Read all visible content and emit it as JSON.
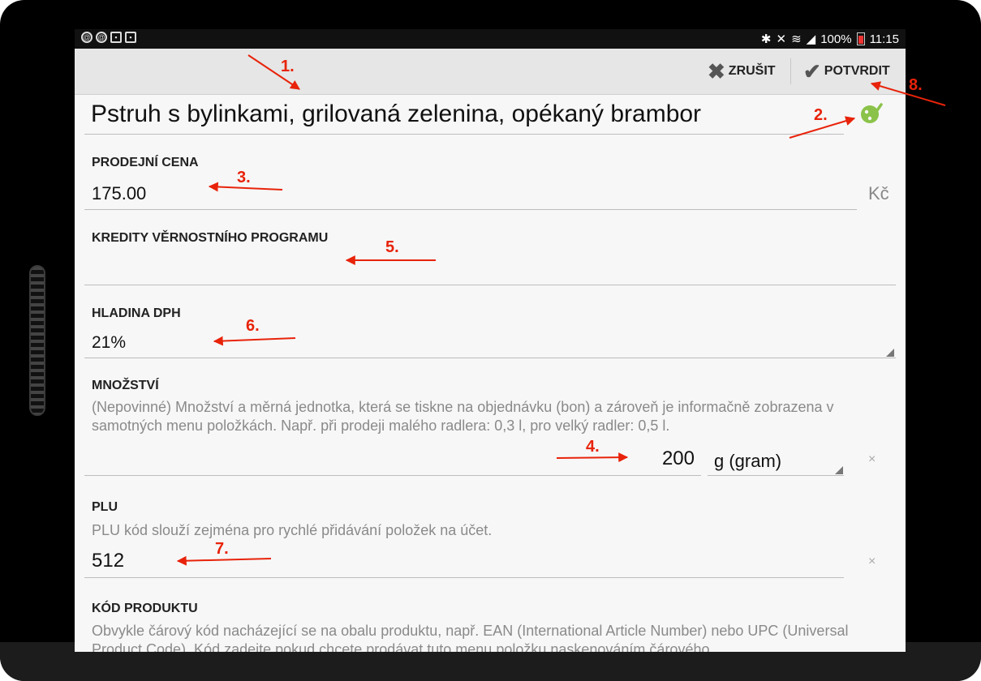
{
  "statusbar": {
    "left_icons": [
      "notification-icon",
      "notification-icon",
      "notification-icon",
      "notification-icon"
    ],
    "battery": "100%",
    "time": "11:15"
  },
  "actionbar": {
    "cancel_label": "ZRUŠIT",
    "confirm_label": "POTVRDIT"
  },
  "form": {
    "name": "Pstruh s bylinkami, grilovaná zelenina, opékaný brambor",
    "price_label": "PRODEJNÍ CENA",
    "price_value": "175.00",
    "currency": "Kč",
    "credits_label": "KREDITY VĚRNOSTNÍHO PROGRAMU",
    "credits_value": "",
    "vat_label": "HLADINA DPH",
    "vat_value": "21%",
    "quantity_label": "MNOŽSTVÍ",
    "quantity_hint": "(Nepovinné) Množství a měrná jednotka, která se tiskne na objednávku (bon) a zároveň je informačně zobrazena v samotných menu položkách. Např. při prodeji malého radlera: 0,3 l, pro velký radler: 0,5 l.",
    "quantity_value": "200",
    "unit_value": "g (gram)",
    "plu_label": "PLU",
    "plu_hint": "PLU kód slouží zejména pro rychlé přidávání položek na účet.",
    "plu_value": "512",
    "product_code_label": "KÓD PRODUKTU",
    "product_code_hint": "Obvykle čárový kód nacházející se na obalu produktu, např. EAN (International Article Number) nebo UPC (Universal Product Code). Kód zadejte pokud chcete prodávat tuto menu položku naskenováním čárového"
  },
  "annotations": [
    "1.",
    "2.",
    "3.",
    "4.",
    "5.",
    "6.",
    "7.",
    "8."
  ],
  "colors": {
    "annotation": "#e8230a",
    "palette_icon": "#8bc34a"
  }
}
